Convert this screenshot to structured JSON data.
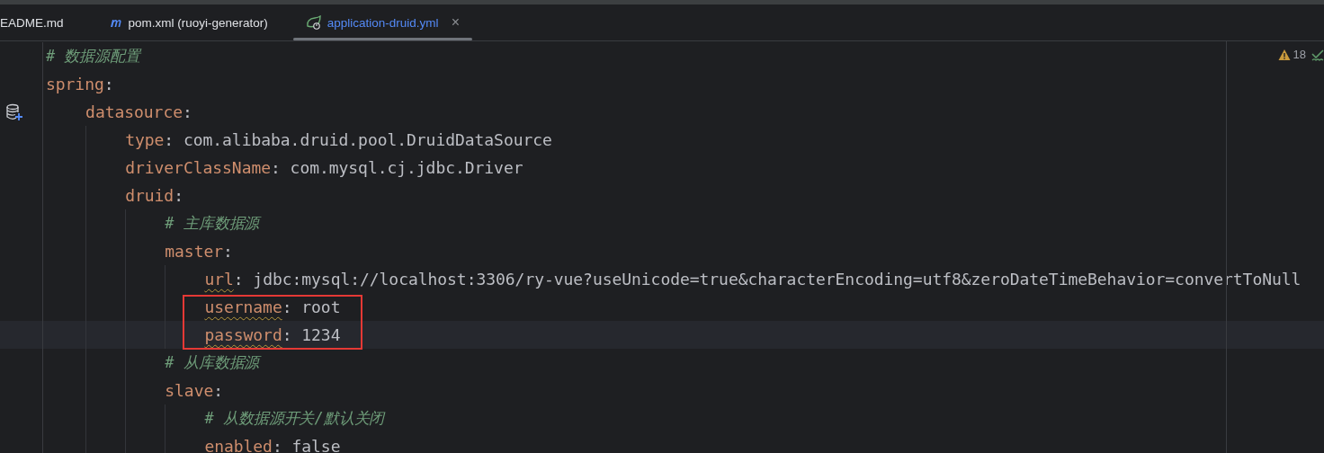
{
  "tabs": [
    {
      "label": "EADME.md",
      "kind": "plain",
      "selected": false,
      "closable": false
    },
    {
      "label": "pom.xml (ruoyi-generator)",
      "kind": "maven",
      "selected": false,
      "closable": false
    },
    {
      "label": "application-druid.yml",
      "kind": "spring",
      "selected": true,
      "closable": true
    }
  ],
  "close_glyph": "×",
  "inspections": {
    "warnings": "18"
  },
  "code": [
    {
      "kind": "comment",
      "text": "# 数据源配置"
    },
    {
      "kind": "key",
      "key": "spring",
      "sep": ":",
      "children": [
        {
          "kind": "key",
          "key": "datasource",
          "sep": ":",
          "gutter_action": true,
          "children": [
            {
              "kind": "key",
              "key": "type",
              "sep": ":",
              "value": "com.alibaba.druid.pool.DruidDataSource"
            },
            {
              "kind": "key",
              "key": "driverClassName",
              "sep": ":",
              "value": "com.mysql.cj.jdbc.Driver"
            },
            {
              "kind": "key",
              "key": "druid",
              "sep": ":",
              "children": [
                {
                  "kind": "comment",
                  "text": "# 主库数据源"
                },
                {
                  "kind": "key",
                  "key": "master",
                  "sep": ":",
                  "children": [
                    {
                      "kind": "key",
                      "key": "url",
                      "sep": ":",
                      "value": "jdbc:mysql://localhost:3306/ry-vue?useUnicode=true&characterEncoding=utf8&zeroDateTimeBehavior=convertToNull",
                      "warning": true
                    },
                    {
                      "kind": "key",
                      "key": "username",
                      "sep": ":",
                      "value": "root",
                      "warning": true,
                      "boxed": true
                    },
                    {
                      "kind": "key",
                      "key": "password",
                      "sep": ":",
                      "value": "1234",
                      "warning": true,
                      "boxed": true,
                      "current": true
                    }
                  ]
                },
                {
                  "kind": "comment",
                  "text": "# 从库数据源"
                },
                {
                  "kind": "key",
                  "key": "slave",
                  "sep": ":",
                  "children": [
                    {
                      "kind": "comment",
                      "text": "# 从数据源开关/默认关闭"
                    },
                    {
                      "kind": "key",
                      "key": "enabled",
                      "sep": ":",
                      "value": "false"
                    }
                  ]
                }
              ]
            }
          ]
        }
      ]
    }
  ]
}
